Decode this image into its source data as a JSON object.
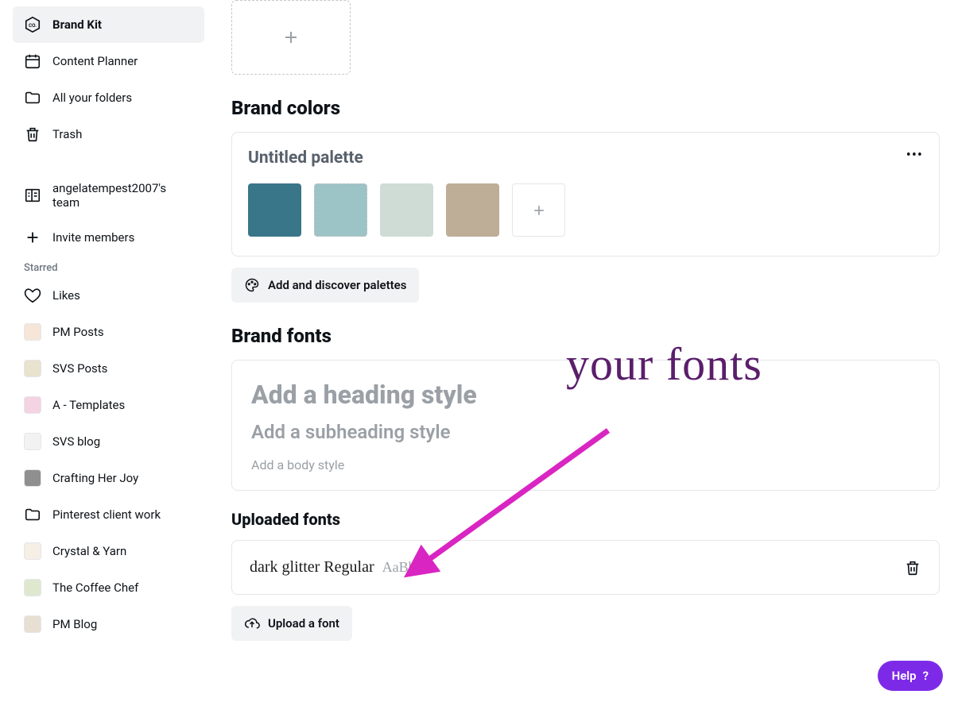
{
  "sidebar": {
    "brand_kit": "Brand Kit",
    "content_planner": "Content Planner",
    "all_folders": "All your folders",
    "trash": "Trash",
    "team": "angelatempest2007's team",
    "invite": "Invite members",
    "starred_heading": "Starred",
    "likes": "Likes",
    "starred": [
      {
        "label": "PM Posts",
        "bg": "#f6e6d8",
        "fg": "#c64040"
      },
      {
        "label": "SVS Posts",
        "bg": "#e8e2ce",
        "fg": "#3a3a3a"
      },
      {
        "label": "A - Templates",
        "bg": "#f4d3e2",
        "fg": "#b04a8a"
      },
      {
        "label": "SVS blog",
        "bg": "#f2f2f2",
        "fg": "#9a9a9a"
      },
      {
        "label": "Crafting Her Joy",
        "bg": "#8f8f8f",
        "fg": "#ffffff"
      },
      {
        "label": "Pinterest client work",
        "bg": "transparent",
        "fg": "#0e1318",
        "folder": true
      },
      {
        "label": "Crystal & Yarn",
        "bg": "#f6efe6",
        "fg": "#b0a38a"
      },
      {
        "label": "The Coffee Chef",
        "bg": "#dfe8cf",
        "fg": "#5a7a3a"
      },
      {
        "label": "PM Blog",
        "bg": "#e8dfd3",
        "fg": "#b08a6a"
      }
    ]
  },
  "sections": {
    "brand_colors": "Brand colors",
    "brand_fonts": "Brand fonts",
    "uploaded_fonts": "Uploaded fonts"
  },
  "palette": {
    "title": "Untitled palette",
    "colors": [
      "#3a7689",
      "#9cc3c6",
      "#cedcd5",
      "#beae97"
    ],
    "add_btn": "Add and discover palettes"
  },
  "fonts": {
    "heading": "Add a heading style",
    "subheading": "Add a subheading style",
    "body": "Add a body style"
  },
  "uploaded": {
    "font_name": "dark glitter Regular",
    "sample": "AaBbCc",
    "upload_btn": "Upload a font"
  },
  "help": "Help",
  "annotation": "your fonts"
}
